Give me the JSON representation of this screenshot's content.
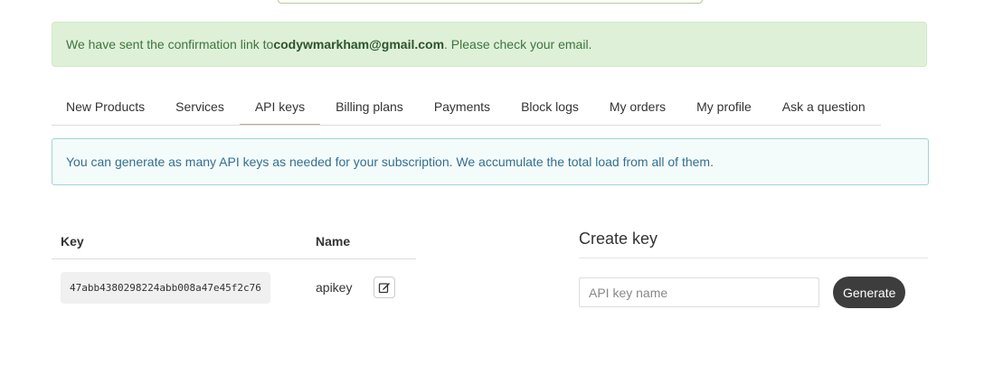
{
  "alert_success": {
    "prefix": "We have sent the confirmation link to ",
    "email": "codywmarkham@gmail.com",
    "suffix": ". Please check your email."
  },
  "tabs": [
    {
      "label": "New Products",
      "active": false
    },
    {
      "label": "Services",
      "active": false
    },
    {
      "label": "API keys",
      "active": true
    },
    {
      "label": "Billing plans",
      "active": false
    },
    {
      "label": "Payments",
      "active": false
    },
    {
      "label": "Block logs",
      "active": false
    },
    {
      "label": "My orders",
      "active": false
    },
    {
      "label": "My profile",
      "active": false
    },
    {
      "label": "Ask a question",
      "active": false
    }
  ],
  "alert_info": {
    "text": "You can generate as many API keys as needed for your subscription. We accumulate the total load from all of them."
  },
  "keys_table": {
    "columns": [
      "Key",
      "Name"
    ],
    "rows": [
      {
        "key": "47abb4380298224abb008a47e45f2c76",
        "name": "apikey",
        "action_icon": "edit-icon"
      }
    ]
  },
  "create_key": {
    "title": "Create key",
    "input_placeholder": "API key name",
    "input_value": "",
    "button_label": "Generate"
  },
  "colors": {
    "success_bg": "#dff0d8",
    "success_text": "#3c763d",
    "info_bg": "#f4fbfb",
    "info_border": "#9fd6d2",
    "info_text": "#31708f",
    "button_dark": "#3d3d3d",
    "active_tab_border": "#c9a98a"
  }
}
